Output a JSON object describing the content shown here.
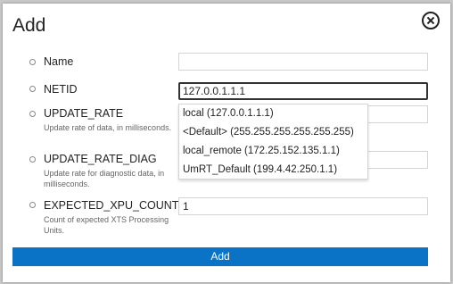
{
  "dialog": {
    "title": "Add",
    "submit_label": "Add"
  },
  "fields": [
    {
      "label": "Name",
      "value": "",
      "help": ""
    },
    {
      "label": "NETID",
      "value": "127.0.0.1.1.1",
      "help": ""
    },
    {
      "label": "UPDATE_RATE",
      "value": "",
      "help": "Update rate of data, in milliseconds."
    },
    {
      "label": "UPDATE_RATE_DIAG",
      "value": "",
      "help": "Update rate for diagnostic data, in milliseconds."
    },
    {
      "label": "EXPECTED_XPU_COUNT",
      "value": "1",
      "help": "Count of expected XTS Processing Units."
    }
  ],
  "netid_options": [
    "local (127.0.0.1.1.1)",
    "<Default> (255.255.255.255.255.255)",
    "local_remote (172.25.152.135.1.1)",
    "UmRT_Default (199.4.42.250.1.1)"
  ],
  "colors": {
    "accent": "#0b73c6",
    "background": "#ffffff",
    "focus_border": "#333333"
  }
}
